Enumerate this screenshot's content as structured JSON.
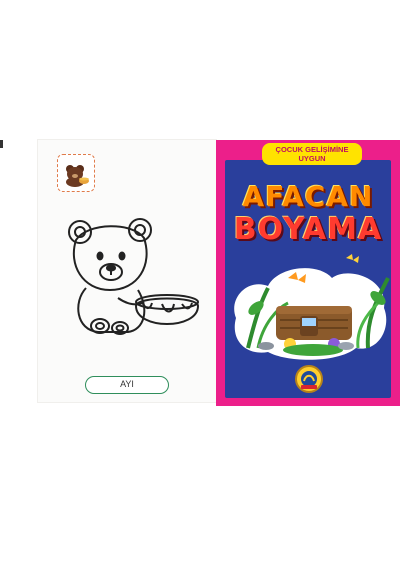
{
  "left_page": {
    "label": "AYI",
    "thumbnail_icon": "bear-with-honey-pot-icon",
    "drawing_icon": "bear-outline-coloring-icon"
  },
  "cover": {
    "tagline_line1": "ÇOCUK GELİŞİMİNE",
    "tagline_line2": "UYGUN",
    "title_line1": "AFACAN",
    "title_line2": "BOYAMA",
    "ribbon_text": "",
    "illustration_icon": "tree-stump-house-garden-icon",
    "publisher_logo": "publisher-badge-icon"
  },
  "colors": {
    "cover_border": "#ec1f8a",
    "cover_panel": "#2a3f9c",
    "tagline_bg": "#ffe300",
    "label_border": "#2f8e5b"
  }
}
